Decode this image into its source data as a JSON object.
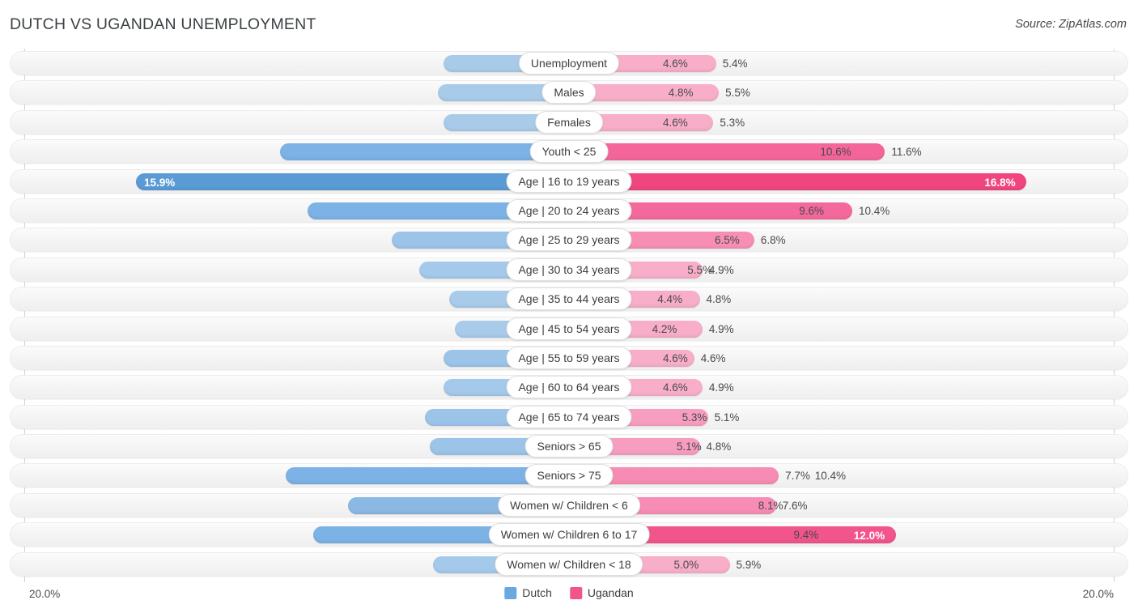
{
  "header": {
    "title": "DUTCH VS UGANDAN UNEMPLOYMENT",
    "source": "Source: ZipAtlas.com"
  },
  "axis": {
    "min_label": "20.0%",
    "max_label": "20.0%",
    "max_value": 20.0
  },
  "legend": {
    "items": [
      {
        "label": "Dutch",
        "color": "#6aa8e0"
      },
      {
        "label": "Ugandan",
        "color": "#f2548c"
      }
    ]
  },
  "colors": {
    "blue_light": "#a8cbea",
    "blue_mid": "#8cb8e4",
    "blue_dark": "#6aa8e0",
    "pink_light": "#f8aec9",
    "pink_mid": "#f591b5",
    "pink_dark": "#f2548c",
    "track": "#f4f4f4",
    "axis": "#d2d2d2"
  },
  "chart_data": {
    "type": "bar",
    "title": "DUTCH VS UGANDAN UNEMPLOYMENT",
    "subtitle": "",
    "xlabel": "",
    "ylabel": "",
    "orientation": "horizontal-diverging",
    "xlim": [
      0,
      20
    ],
    "grid": false,
    "legend_position": "bottom-center",
    "categories": [
      "Unemployment",
      "Males",
      "Females",
      "Youth < 25",
      "Age | 16 to 19 years",
      "Age | 20 to 24 years",
      "Age | 25 to 29 years",
      "Age | 30 to 34 years",
      "Age | 35 to 44 years",
      "Age | 45 to 54 years",
      "Age | 55 to 59 years",
      "Age | 60 to 64 years",
      "Age | 65 to 74 years",
      "Seniors > 65",
      "Seniors > 75",
      "Women w/ Children < 6",
      "Women w/ Children 6 to 17",
      "Women w/ Children < 18"
    ],
    "series": [
      {
        "name": "Dutch",
        "values": [
          4.6,
          4.8,
          4.6,
          10.6,
          15.9,
          9.6,
          6.5,
          5.5,
          4.4,
          4.2,
          4.6,
          4.6,
          5.3,
          5.1,
          10.4,
          8.1,
          9.4,
          5.0
        ]
      },
      {
        "name": "Ugandan",
        "values": [
          5.4,
          5.5,
          5.3,
          11.6,
          16.8,
          10.4,
          6.8,
          4.9,
          4.8,
          4.9,
          4.6,
          4.9,
          5.1,
          4.8,
          7.7,
          7.6,
          12.0,
          5.9
        ]
      }
    ]
  },
  "rows": [
    {
      "label": "Unemployment",
      "left": {
        "text": "4.6%",
        "value": 4.6,
        "color": "#a8cbea",
        "inside": false
      },
      "right": {
        "text": "5.4%",
        "value": 5.4,
        "color": "#f8aec9",
        "inside": false
      }
    },
    {
      "label": "Males",
      "left": {
        "text": "4.8%",
        "value": 4.8,
        "color": "#a8cbea",
        "inside": false
      },
      "right": {
        "text": "5.5%",
        "value": 5.5,
        "color": "#f8aec9",
        "inside": false
      }
    },
    {
      "label": "Females",
      "left": {
        "text": "4.6%",
        "value": 4.6,
        "color": "#a8cbea",
        "inside": false
      },
      "right": {
        "text": "5.3%",
        "value": 5.3,
        "color": "#f8aec9",
        "inside": false
      }
    },
    {
      "label": "Youth < 25",
      "left": {
        "text": "10.6%",
        "value": 10.6,
        "color": "#7cb2e5",
        "inside": false
      },
      "right": {
        "text": "11.6%",
        "value": 11.6,
        "color": "#f4669a",
        "inside": false
      }
    },
    {
      "label": "Age | 16 to 19 years",
      "left": {
        "text": "15.9%",
        "value": 15.9,
        "color": "#5b9bd5",
        "inside": true
      },
      "right": {
        "text": "16.8%",
        "value": 16.8,
        "color": "#f0457f",
        "inside": true
      }
    },
    {
      "label": "Age | 20 to 24 years",
      "left": {
        "text": "9.6%",
        "value": 9.6,
        "color": "#7cb2e5",
        "inside": false
      },
      "right": {
        "text": "10.4%",
        "value": 10.4,
        "color": "#f4699c",
        "inside": false
      }
    },
    {
      "label": "Age | 25 to 29 years",
      "left": {
        "text": "6.5%",
        "value": 6.5,
        "color": "#9cc4e9",
        "inside": false
      },
      "right": {
        "text": "6.8%",
        "value": 6.8,
        "color": "#f78fb5",
        "inside": false
      }
    },
    {
      "label": "Age | 30 to 34 years",
      "left": {
        "text": "5.5%",
        "value": 5.5,
        "color": "#a5c9ea",
        "inside": false
      },
      "right": {
        "text": "4.9%",
        "value": 4.9,
        "color": "#f8aec9",
        "inside": false
      }
    },
    {
      "label": "Age | 35 to 44 years",
      "left": {
        "text": "4.4%",
        "value": 4.4,
        "color": "#a8cbea",
        "inside": false
      },
      "right": {
        "text": "4.8%",
        "value": 4.8,
        "color": "#f8aec9",
        "inside": false
      }
    },
    {
      "label": "Age | 45 to 54 years",
      "left": {
        "text": "4.2%",
        "value": 4.2,
        "color": "#a8cbea",
        "inside": false
      },
      "right": {
        "text": "4.9%",
        "value": 4.9,
        "color": "#f8aec9",
        "inside": false
      }
    },
    {
      "label": "Age | 55 to 59 years",
      "left": {
        "text": "4.6%",
        "value": 4.6,
        "color": "#9cc4e9",
        "inside": false
      },
      "right": {
        "text": "4.6%",
        "value": 4.6,
        "color": "#f8aec9",
        "inside": false
      }
    },
    {
      "label": "Age | 60 to 64 years",
      "left": {
        "text": "4.6%",
        "value": 4.6,
        "color": "#a5c9ea",
        "inside": false
      },
      "right": {
        "text": "4.9%",
        "value": 4.9,
        "color": "#f8aec9",
        "inside": false
      }
    },
    {
      "label": "Age | 65 to 74 years",
      "left": {
        "text": "5.3%",
        "value": 5.3,
        "color": "#9cc4e9",
        "inside": false
      },
      "right": {
        "text": "5.1%",
        "value": 5.1,
        "color": "#f79ec0",
        "inside": false
      }
    },
    {
      "label": "Seniors > 65",
      "left": {
        "text": "5.1%",
        "value": 5.1,
        "color": "#9cc4e9",
        "inside": false
      },
      "right": {
        "text": "4.8%",
        "value": 4.8,
        "color": "#f79ec0",
        "inside": false
      }
    },
    {
      "label": "Seniors > 75",
      "left": {
        "text": "10.4%",
        "value": 10.4,
        "color": "#7cb2e5",
        "inside": false
      },
      "right": {
        "text": "7.7%",
        "value": 7.7,
        "color": "#f68cb3",
        "inside": false
      }
    },
    {
      "label": "Women w/ Children < 6",
      "left": {
        "text": "8.1%",
        "value": 8.1,
        "color": "#8cb8e4",
        "inside": false
      },
      "right": {
        "text": "7.6%",
        "value": 7.6,
        "color": "#f78cb4",
        "inside": false
      }
    },
    {
      "label": "Women w/ Children 6 to 17",
      "left": {
        "text": "9.4%",
        "value": 9.4,
        "color": "#7cb2e5",
        "inside": false
      },
      "right": {
        "text": "12.0%",
        "value": 12.0,
        "color": "#f2548c",
        "inside": true
      }
    },
    {
      "label": "Women w/ Children < 18",
      "left": {
        "text": "5.0%",
        "value": 5.0,
        "color": "#a5c9ea",
        "inside": false
      },
      "right": {
        "text": "5.9%",
        "value": 5.9,
        "color": "#f8aec9",
        "inside": false
      }
    }
  ]
}
